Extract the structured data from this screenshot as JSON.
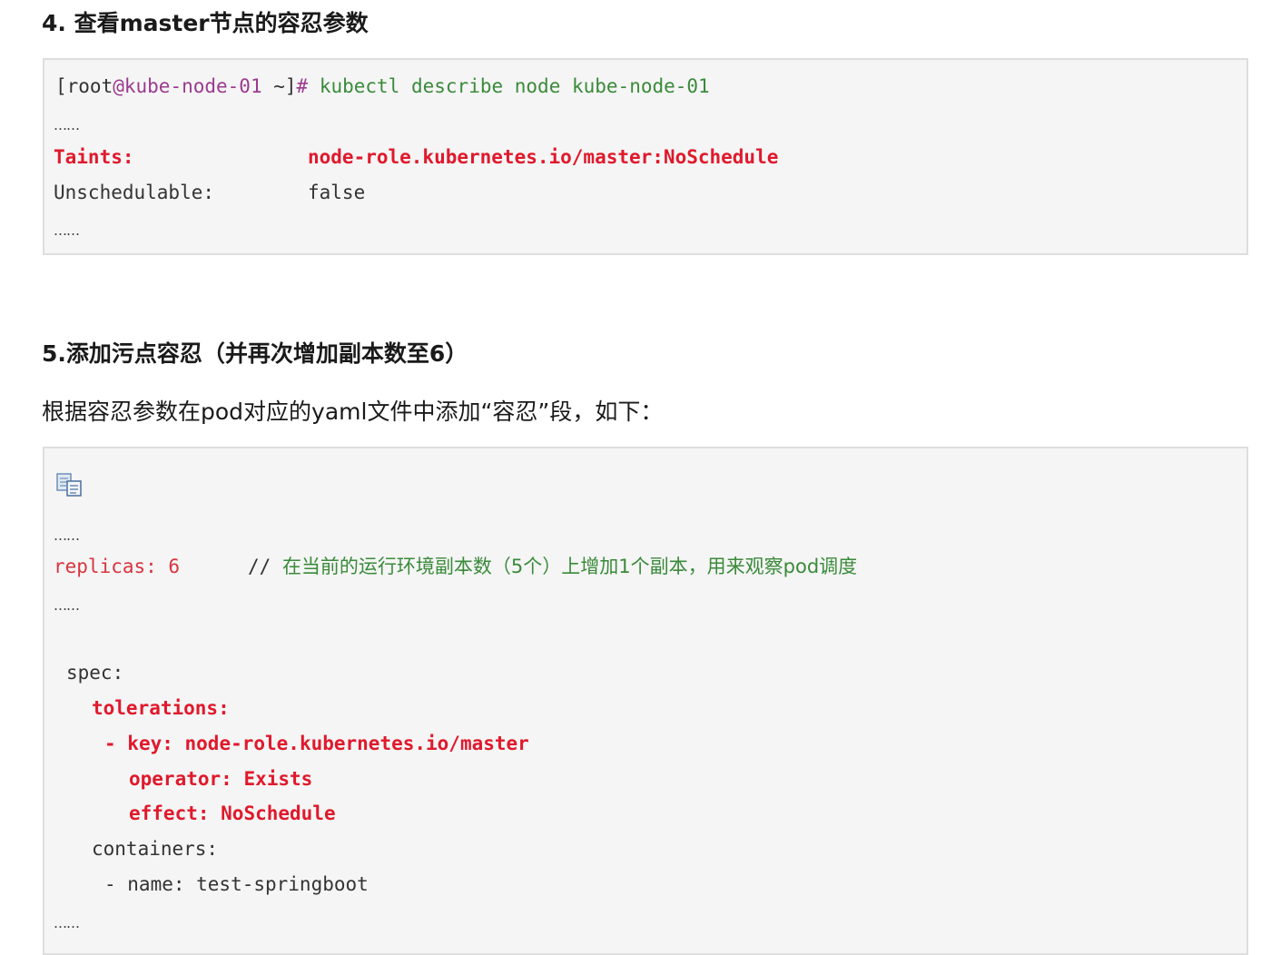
{
  "section4": {
    "heading": "4. 查看master节点的容忍参数",
    "code": {
      "prompt_open": "[root",
      "prompt_at": "@",
      "prompt_host": "kube-node-01",
      "prompt_close": " ~]",
      "prompt_hash": "# ",
      "command": "kubectl describe node kube-node-01",
      "dots1": "……",
      "taints_key": "Taints:",
      "taints_value": "node-role.kubernetes.io/master:NoSchedule",
      "unsched_key": "Unschedulable:",
      "unsched_value": "false",
      "dots2": "……"
    }
  },
  "section5": {
    "heading": "5.添加污点容忍（并再次增加副本数至6）",
    "description": "根据容忍参数在pod对应的yaml文件中添加“容忍”段，如下：",
    "copy_icon": "copy-icon",
    "code": {
      "dots1": "……",
      "replicas": "replicas: 6",
      "comment_slashes": "// ",
      "comment_text": "在当前的运行环境副本数（5个）上增加1个副本，用来观察pod调度",
      "dots2": "……",
      "spec": "spec:",
      "tolerations": "tolerations:",
      "key_line_dash": "- ",
      "key_line_key": "key: ",
      "key_line_value": "node-role.kubernetes.io/master",
      "operator_key": "operator: ",
      "operator_value": "Exists",
      "effect_key": "effect: ",
      "effect_value": "NoSchedule",
      "containers": "containers:",
      "name_line": "- name: test-springboot",
      "dots3": "……"
    }
  },
  "colors": {
    "taint_red": "#e0192c",
    "replicas_red": "#d9343f",
    "command_green": "#3a8a3a",
    "host_purple": "#9b3a8f",
    "code_background": "#f5f5f5"
  }
}
